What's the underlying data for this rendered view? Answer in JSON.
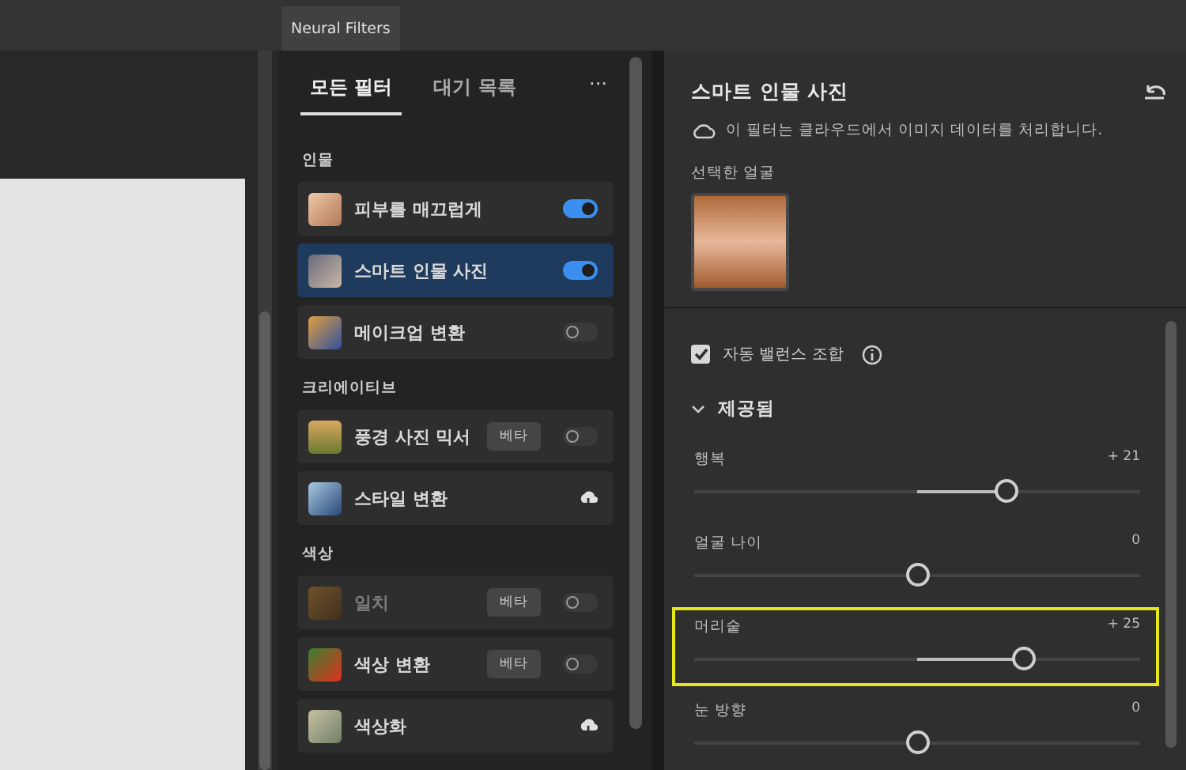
{
  "panel_tab": "Neural Filters",
  "filter_tabs": [
    {
      "label": "모든 필터",
      "selected": true
    },
    {
      "label": "대기 목록",
      "selected": false
    }
  ],
  "more_menu": "···",
  "categories": [
    {
      "name": "인물",
      "filters": [
        {
          "name": "피부를 매끄럽게",
          "kind": "toggle",
          "on": true,
          "selected": false,
          "disabled": false
        },
        {
          "name": "스마트 인물 사진",
          "kind": "toggle",
          "on": true,
          "selected": true,
          "disabled": false
        },
        {
          "name": "메이크업 변환",
          "kind": "toggle",
          "on": false,
          "selected": false,
          "disabled": false
        }
      ]
    },
    {
      "name": "크리에이티브",
      "filters": [
        {
          "name": "풍경 사진 믹서",
          "kind": "toggle",
          "badge": "베타",
          "on": false,
          "selected": false,
          "disabled": false
        },
        {
          "name": "스타일 변환",
          "kind": "download",
          "selected": false,
          "disabled": false
        }
      ]
    },
    {
      "name": "색상",
      "filters": [
        {
          "name": "일치",
          "kind": "toggle",
          "badge": "베타",
          "on": false,
          "selected": false,
          "disabled": true
        },
        {
          "name": "색상 변환",
          "kind": "toggle",
          "badge": "베타",
          "on": false,
          "selected": false,
          "disabled": false
        },
        {
          "name": "색상화",
          "kind": "download",
          "selected": false,
          "disabled": false
        }
      ]
    }
  ],
  "detail": {
    "title": "스마트 인물 사진",
    "cloud_note": "이 필터는 클라우드에서 이미지 데이터를 처리합니다.",
    "face_label": "선택한 얼굴",
    "auto_balance": {
      "label": "자동 밸런스 조합",
      "checked": true
    },
    "section": {
      "label": "제공됨",
      "expanded": true
    },
    "sliders": [
      {
        "name": "행복",
        "reading": "+ 21",
        "level": 0.7,
        "highlighted": false
      },
      {
        "name": "얼굴 나이",
        "reading": "0",
        "level": 0.5,
        "highlighted": false
      },
      {
        "name": "머리숱",
        "reading": "+ 25",
        "level": 0.74,
        "highlighted": true
      },
      {
        "name": "눈 방향",
        "reading": "0",
        "level": 0.5,
        "highlighted": false
      }
    ]
  }
}
